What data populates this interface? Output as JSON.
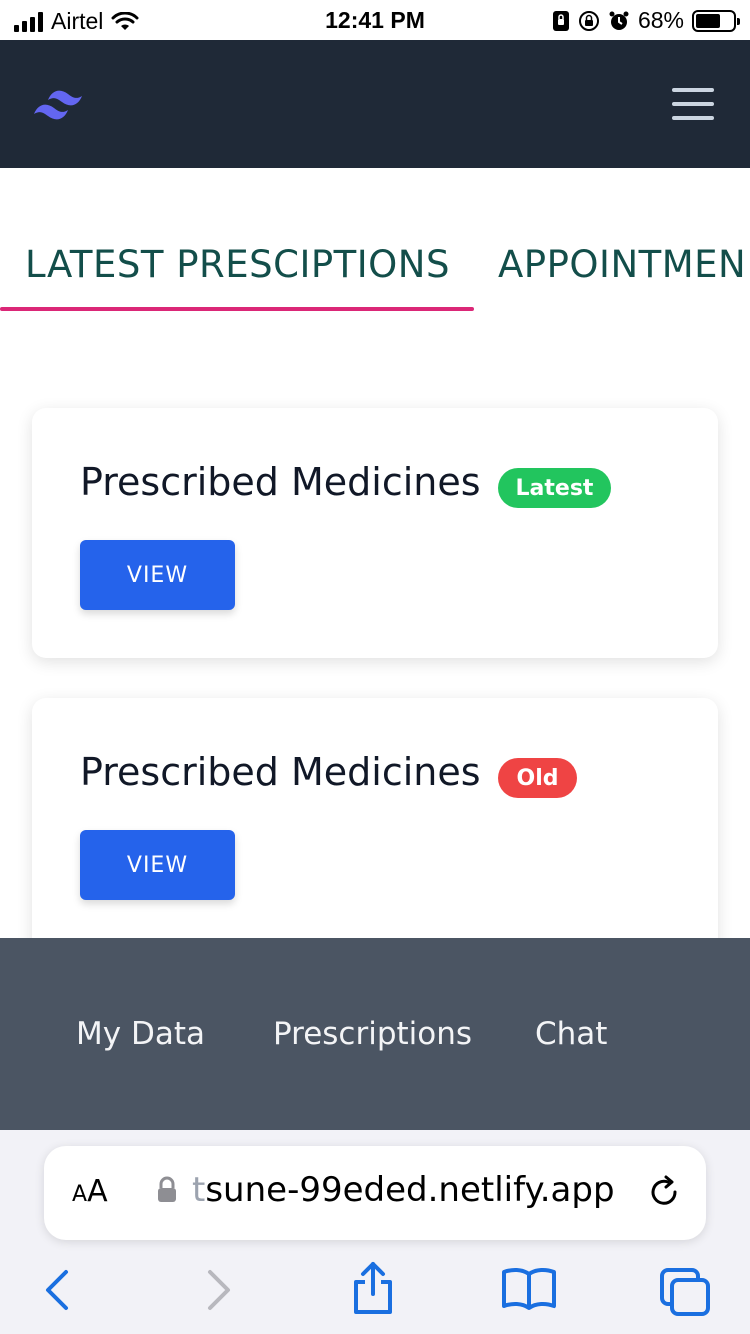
{
  "status_bar": {
    "carrier": "Airtel",
    "time": "12:41 PM",
    "battery": "68%"
  },
  "navbar": {
    "logo_icon": "tailwind-wave-logo",
    "menu_icon": "hamburger-menu-icon"
  },
  "tabs": [
    {
      "label": "LATEST PRESCIPTIONS",
      "active": true
    },
    {
      "label": "APPOINTMEN",
      "active": false
    }
  ],
  "cards": [
    {
      "title": "Prescribed Medicines",
      "badge": "Latest",
      "button": "VIEW"
    },
    {
      "title": "Prescribed Medicines",
      "badge": "Old",
      "button": "VIEW"
    }
  ],
  "footer": {
    "links": [
      "My Data",
      "Prescriptions",
      "Chat"
    ]
  },
  "browser": {
    "aa_large": "A",
    "aa_small": "A",
    "url_faded": "t",
    "url": "sune-99eded.netlify.app"
  },
  "colors": {
    "navbar_bg": "#1f2937",
    "tab_text": "#134e4a",
    "tab_underline": "#db2777",
    "badge_latest": "#22c55e",
    "badge_old": "#ef4444",
    "button": "#2563eb",
    "footer_bg": "#4b5563",
    "safari_blue": "#1a6fe0"
  }
}
